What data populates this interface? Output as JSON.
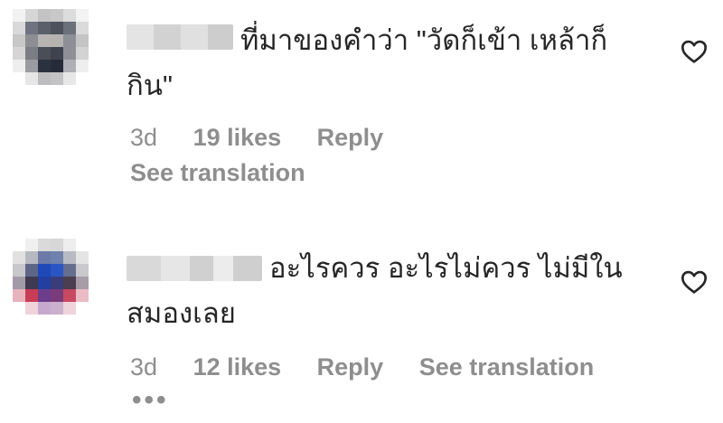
{
  "comments": [
    {
      "text": "ที่มาของคำว่า \"วัดก็เข้า เหล้าก็กิน\"",
      "time": "3d",
      "likes": "19 likes",
      "reply": "Reply",
      "translate": "See translation",
      "more": ""
    },
    {
      "text": "อะไรควร อะไรไม่ควร ไม่มีในสมองเลย",
      "time": "3d",
      "likes": "12 likes",
      "reply": "Reply",
      "translate": "See translation",
      "more": "•••"
    }
  ],
  "colors": {
    "text": "#262626",
    "secondary": "#8e8e8e",
    "background": "#ffffff"
  },
  "icons": {
    "like": "heart-outline-icon",
    "more": "more-dots-icon"
  }
}
